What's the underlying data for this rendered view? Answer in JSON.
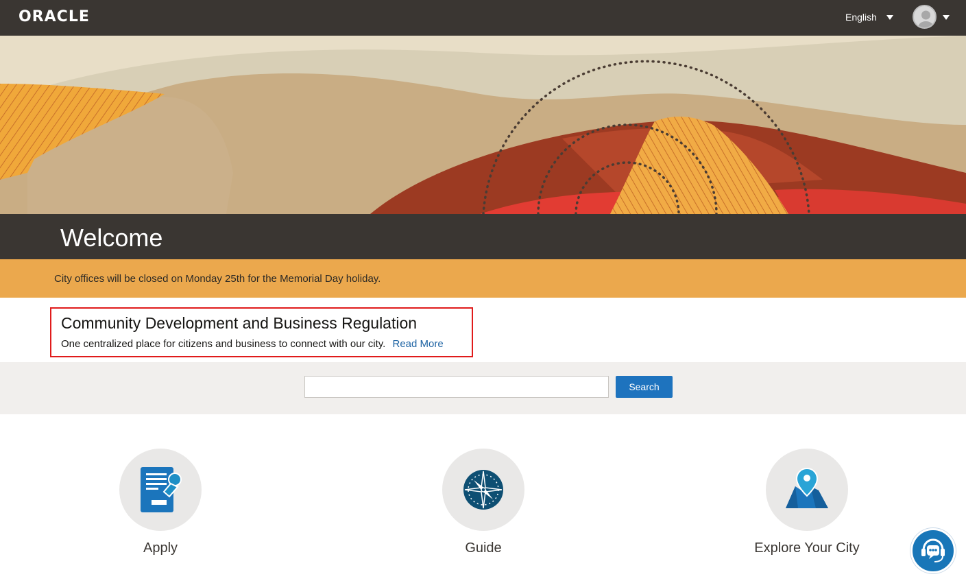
{
  "header": {
    "logo_text": "ORACLE",
    "language": "English",
    "avatar_icon": "user-avatar-icon"
  },
  "welcome": {
    "title": "Welcome"
  },
  "announcement": {
    "text": "City offices will be closed on Monday 25th for the Memorial Day holiday."
  },
  "intro": {
    "title": "Community Development and Business Regulation",
    "description": "One centralized place for citizens and business to connect with our city.",
    "read_more": "Read More"
  },
  "search": {
    "value": "",
    "placeholder": "",
    "button_label": "Search"
  },
  "tiles": [
    {
      "label": "Apply",
      "icon": "apply-stamp-icon"
    },
    {
      "label": "Guide",
      "icon": "compass-icon"
    },
    {
      "label": "Explore Your City",
      "icon": "map-pin-icon"
    }
  ],
  "chat": {
    "icon": "chat-assistant-icon"
  },
  "colors": {
    "topbar": "#3a3632",
    "announcement": "#eba84d",
    "primary": "#1e73be",
    "link": "#1d63a3",
    "highlight_border": "#e01b1b",
    "icon_blue": "#1b75bc",
    "icon_dark": "#0e4f73"
  }
}
